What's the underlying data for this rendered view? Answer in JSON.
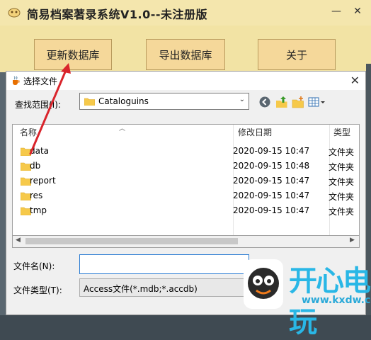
{
  "app": {
    "title": "简易档案著录系统V1.0--未注册版",
    "buttons": [
      "更新数据库",
      "导出数据库",
      "关于"
    ],
    "minimize_glyph": "—",
    "close_glyph": "✕"
  },
  "dialog": {
    "title": "选择文件",
    "close_glyph": "✕",
    "look_in_label": "查找范围(I):",
    "look_in_value": "Cataloguins",
    "columns": {
      "name": "名称",
      "date": "修改日期",
      "type": "类型"
    },
    "files": [
      {
        "name": "data",
        "date": "2020-09-15 10:47",
        "type": "文件夹"
      },
      {
        "name": "db",
        "date": "2020-09-15 10:48",
        "type": "文件夹"
      },
      {
        "name": "report",
        "date": "2020-09-15 10:47",
        "type": "文件夹"
      },
      {
        "name": "res",
        "date": "2020-09-15 10:47",
        "type": "文件夹"
      },
      {
        "name": "tmp",
        "date": "2020-09-15 10:47",
        "type": "文件夹"
      }
    ],
    "filename_label": "文件名(N):",
    "filename_value": "",
    "filetype_label": "文件类型(T):",
    "filetype_value": "Access文件(*.mdb;*.accdb)"
  },
  "watermark": {
    "text": "开心电玩",
    "url": "www.kxdw.com"
  },
  "colors": {
    "app_bg": "#f2e3a4",
    "button_bg": "#f5d89a",
    "folder": "#f6c94a",
    "annotation_arrow": "#d9242b",
    "watermark": "#29b7e6"
  }
}
